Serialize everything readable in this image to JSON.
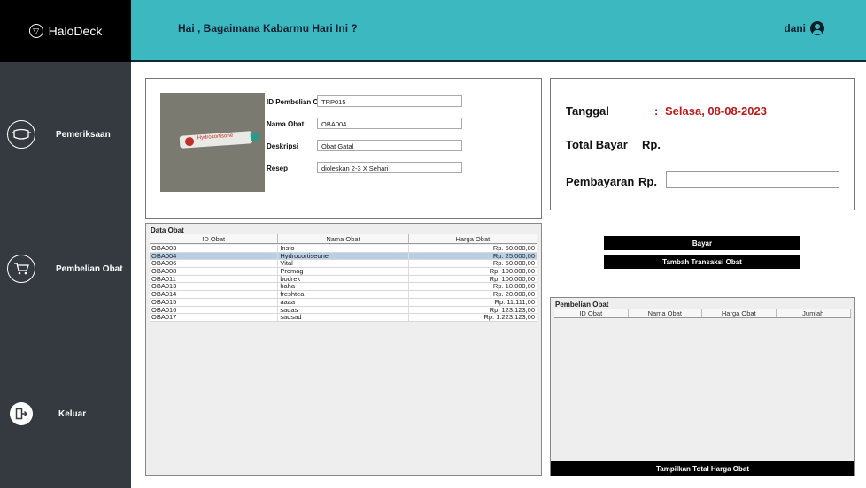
{
  "app": {
    "logo": "HaloDeck"
  },
  "header": {
    "greeting": "Hai , Bagaimana Kabarmu Hari Ini ?",
    "username": "dani"
  },
  "sidebar": {
    "items": [
      {
        "label": "Pemeriksaan",
        "icon": "mask-icon"
      },
      {
        "label": "Pembelian Obat",
        "icon": "cart-icon"
      },
      {
        "label": "Keluar",
        "icon": "exit-icon"
      }
    ]
  },
  "product": {
    "image_label": "Hydrocortisone",
    "id_pembelian_label": "ID Pembelian Obat",
    "id_pembelian_value": "TRP015",
    "nama_obat_label": "Nama Obat",
    "nama_obat_value": "OBA004",
    "deskripsi_label": "Deskripsi",
    "deskripsi_value": "Obat Gatal",
    "resep_label": "Resep",
    "resep_value": "dioleskan 2-3 X Sehari"
  },
  "payment": {
    "tanggal_label": "Tanggal",
    "colon": ":",
    "tanggal_value": "Selasa, 08-08-2023",
    "total_label": "Total Bayar",
    "total_rp": "Rp.",
    "pembayaran_label": "Pembayaran",
    "pembayaran_rp": "Rp.",
    "pembayaran_value": ""
  },
  "buttons": {
    "bayar": "Bayar",
    "tambah": "Tambah Transaksi Obat",
    "tampilkan": "Tampilkan Total Harga Obat"
  },
  "data_obat": {
    "title": "Data Obat",
    "columns": [
      "ID Obat",
      "Nama Obat",
      "Harga Obat"
    ],
    "rows": [
      [
        "OBA003",
        "Insto",
        "Rp. 50.000,00"
      ],
      [
        "OBA004",
        "Hydrocortiseone",
        "Rp. 25.000,00"
      ],
      [
        "OBA006",
        "Vital",
        "Rp. 50.000,00"
      ],
      [
        "OBA008",
        "Promag",
        "Rp. 100.000,00"
      ],
      [
        "OBA011",
        "bodrek",
        "Rp. 100.000,00"
      ],
      [
        "OBA013",
        "haha",
        "Rp. 10.000,00"
      ],
      [
        "OBA014",
        "freshtea",
        "Rp. 20.000,00"
      ],
      [
        "OBA015",
        "aaaa",
        "Rp. 11.111,00"
      ],
      [
        "OBA016",
        "sadas",
        "Rp. 123.123,00"
      ],
      [
        "OBA017",
        "sadsad",
        "Rp. 1.223.123,00"
      ]
    ],
    "selected_index": 1
  },
  "pembelian_obat": {
    "title": "Pembelian Obat",
    "columns": [
      "ID Obat",
      "Nama Obat",
      "Harga Obat",
      "Jumlah"
    ]
  },
  "colors": {
    "header": "#3cb8c0",
    "sidebar": "#343a40",
    "date": "#b71c1c",
    "selected_row": "#b8cfe6"
  }
}
